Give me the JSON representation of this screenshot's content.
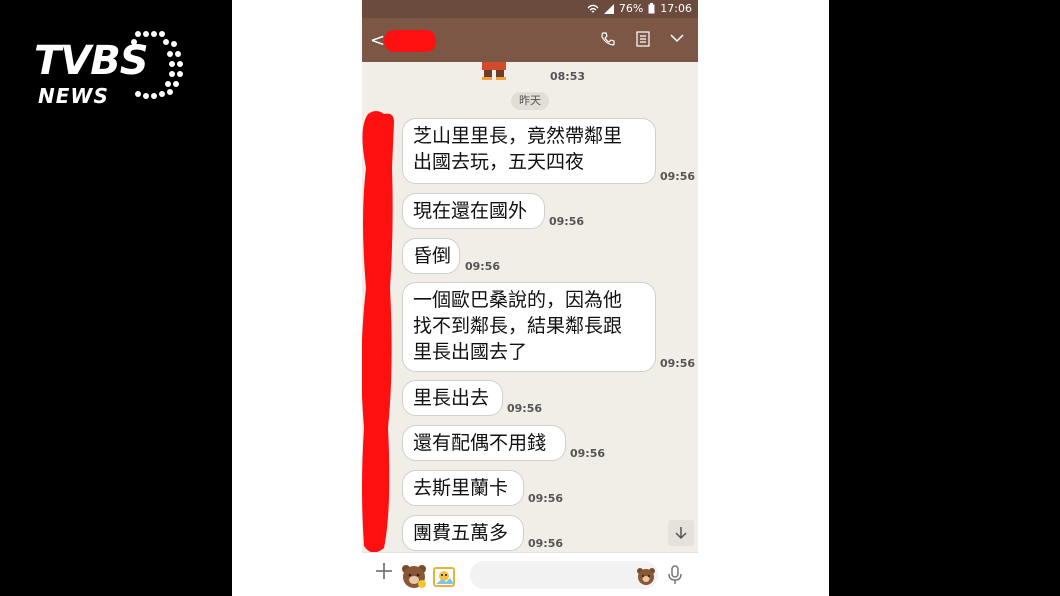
{
  "logo": {
    "brand": "TVBS",
    "sub": "NEWS"
  },
  "status_bar": {
    "battery": "76%",
    "time": "17:06"
  },
  "header": {
    "back_glyph": "<"
  },
  "top_time": "08:53",
  "date_divider": "昨天",
  "messages": [
    {
      "lines": [
        "芝山里里長，竟然帶鄰里",
        "出國去玩，五天四夜"
      ],
      "time": "09:56"
    },
    {
      "lines": [
        "現在還在國外"
      ],
      "time": "09:56"
    },
    {
      "lines": [
        "昏倒"
      ],
      "time": "09:56"
    },
    {
      "lines": [
        "一個歐巴桑說的，因為他",
        "找不到鄰長，結果鄰長跟",
        "里長出國去了"
      ],
      "time": "09:56"
    },
    {
      "lines": [
        "里長出去"
      ],
      "time": "09:56"
    },
    {
      "lines": [
        "還有配偶不用錢"
      ],
      "time": "09:56"
    },
    {
      "lines": [
        "去斯里蘭卡"
      ],
      "time": "09:56"
    },
    {
      "lines": [
        "團費五萬多"
      ],
      "time": "09:56"
    }
  ],
  "icons": {
    "header": [
      "phone-icon",
      "notes-icon",
      "chevron-down-icon"
    ],
    "input": [
      "plus-icon",
      "sticker-icon",
      "photo-icon",
      "emoji-icon",
      "mic-icon"
    ]
  },
  "colors": {
    "header": "#7d5746",
    "status": "#6b4b3e",
    "chat_bg": "#f1eee8",
    "redaction": "#ff1010"
  }
}
